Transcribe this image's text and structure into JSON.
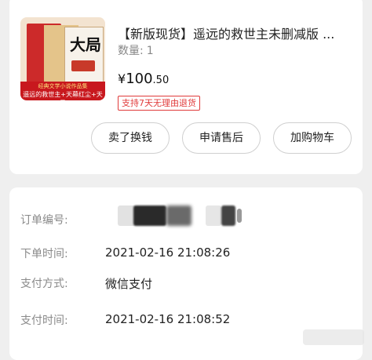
{
  "product": {
    "title": "【新版现货】遥远的救世主未删减版 ...",
    "quantity_label": "数量:",
    "quantity_value": "1",
    "price_currency": "¥",
    "price_int": "100",
    "price_dec": ".50",
    "return_badge": "支持7天无理由退货",
    "thumbnail": {
      "cover_big_char": "大局",
      "band_line1": "经典文学小说作品集",
      "band_line2": "遥远的救世主+天幕红尘+天局"
    }
  },
  "actions": {
    "sell": "卖了换钱",
    "after_sale": "申请售后",
    "add_cart": "加购物车"
  },
  "order": {
    "number_label": "订单编号:",
    "order_time_label": "下单时间:",
    "order_time": "2021-02-16 21:08:26",
    "pay_method_label": "支付方式:",
    "pay_method": "微信支付",
    "pay_time_label": "支付时间:",
    "pay_time": "2021-02-16 21:08:52"
  },
  "colors": {
    "accent_red": "#e03a3a",
    "band_red": "#c8181e"
  }
}
